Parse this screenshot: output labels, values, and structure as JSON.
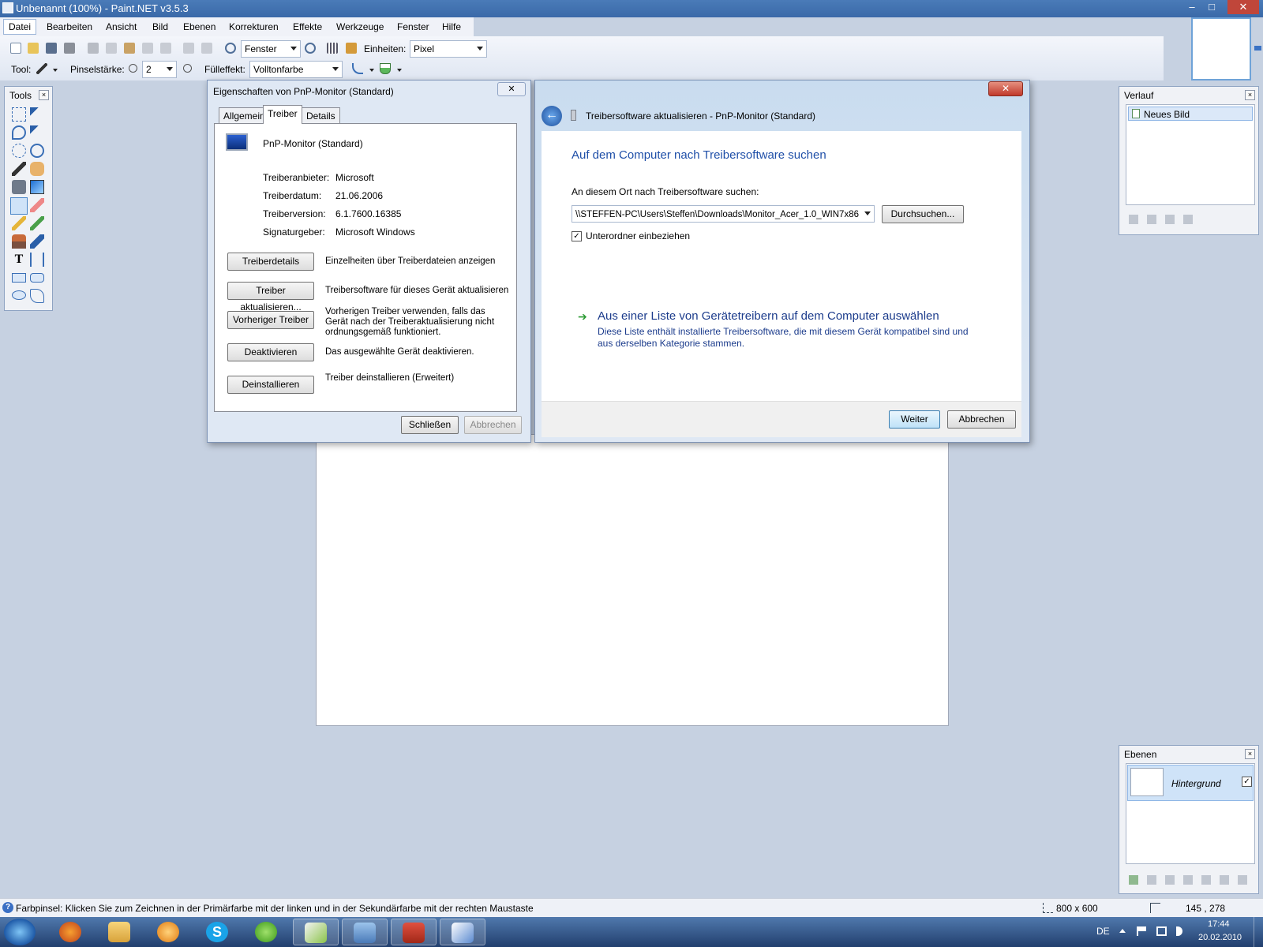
{
  "window": {
    "title": "Unbenannt (100%) - Paint.NET v3.5.3",
    "min": "–",
    "max": "□",
    "close": "✕"
  },
  "menu": [
    "Datei",
    "Bearbeiten",
    "Ansicht",
    "Bild",
    "Ebenen",
    "Korrekturen",
    "Effekte",
    "Werkzeuge",
    "Fenster",
    "Hilfe"
  ],
  "toolbar": {
    "zoom_value": "Fenster",
    "units_label": "Einheiten:",
    "units_value": "Pixel",
    "tool_label": "Tool:",
    "brush_label": "Pinselstärke:",
    "brush_value": "2",
    "fill_label": "Fülleffekt:",
    "fill_value": "Volltonfarbe"
  },
  "tools_panel": {
    "title": "Tools",
    "close": "×"
  },
  "history_panel": {
    "title": "Verlauf",
    "close": "×",
    "items": [
      "Neues Bild"
    ]
  },
  "layers_panel": {
    "title": "Ebenen",
    "close": "×",
    "layer_name": "Hintergrund",
    "checked": "✓"
  },
  "props_dialog": {
    "title": "Eigenschaften von PnP-Monitor (Standard)",
    "close": "✕",
    "tabs": [
      "Allgemein",
      "Treiber",
      "Details"
    ],
    "device_name": "PnP-Monitor (Standard)",
    "rows": [
      {
        "k": "Treiberanbieter:",
        "v": "Microsoft"
      },
      {
        "k": "Treiberdatum:",
        "v": "21.06.2006"
      },
      {
        "k": "Treiberversion:",
        "v": "6.1.7600.16385"
      },
      {
        "k": "Signaturgeber:",
        "v": "Microsoft Windows"
      }
    ],
    "actions": [
      {
        "label": "Treiberdetails",
        "desc": "Einzelheiten über Treiberdateien anzeigen"
      },
      {
        "label": "Treiber aktualisieren...",
        "desc": "Treibersoftware für dieses Gerät aktualisieren"
      },
      {
        "label": "Vorheriger Treiber",
        "desc": "Vorherigen Treiber verwenden, falls das Gerät nach der Treiberaktualisierung nicht ordnungsgemäß funktioniert."
      },
      {
        "label": "Deaktivieren",
        "desc": "Das ausgewählte Gerät deaktivieren."
      },
      {
        "label": "Deinstallieren",
        "desc": "Treiber deinstallieren (Erweitert)"
      }
    ],
    "close_btn": "Schließen",
    "cancel_btn": "Abbrechen"
  },
  "wizard": {
    "title": "Treibersoftware aktualisieren - PnP-Monitor (Standard)",
    "close": "✕",
    "heading": "Auf dem Computer nach Treibersoftware suchen",
    "path_label": "An diesem Ort nach Treibersoftware suchen:",
    "path_value": "\\\\STEFFEN-PC\\Users\\Steffen\\Downloads\\Monitor_Acer_1.0_WIN7x86",
    "browse_btn": "Durchsuchen...",
    "subfolder_label": "Unterordner einbeziehen",
    "subfolder_checked": "✓",
    "link_arrow": "➔",
    "link_title": "Aus einer Liste von Gerätetreibern auf dem Computer auswählen",
    "link_desc": "Diese Liste enthält installierte Treibersoftware, die mit diesem Gerät kompatibel sind und aus derselben Kategorie stammen.",
    "next_btn": "Weiter",
    "cancel_btn": "Abbrechen"
  },
  "statusbar": {
    "help_icon": "?",
    "message": "Farbpinsel: Klicken Sie zum Zeichnen in der Primärfarbe mit der linken und in der Sekundärfarbe mit der rechten Maustaste",
    "size": "800 x 600",
    "coords": "145 , 278"
  },
  "taskbar": {
    "lang": "DE",
    "time": "17:44",
    "date": "20.02.2010"
  },
  "colors": {
    "accent": "#1f4fa8",
    "link_blue": "#1c3c8c",
    "desktop": "#c6d1e1"
  }
}
